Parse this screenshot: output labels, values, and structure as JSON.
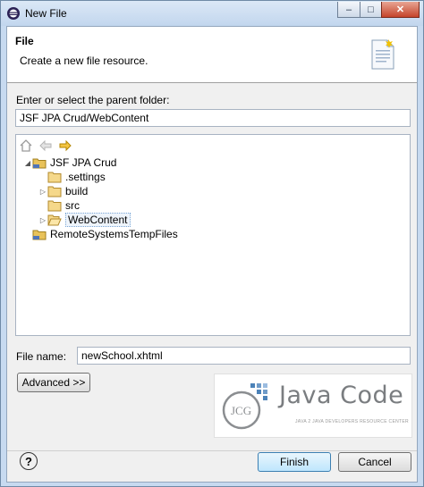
{
  "window": {
    "title": "New File"
  },
  "titlebar": {
    "minimize": "–",
    "maximize": "□",
    "close": "✕"
  },
  "banner": {
    "title": "File",
    "description": "Create a new file resource."
  },
  "parent": {
    "label": "Enter or select the parent folder:",
    "value": "JSF JPA Crud/WebContent"
  },
  "tree": {
    "items": [
      {
        "label": "JSF JPA Crud",
        "arrow": "◢"
      },
      {
        "label": ".settings",
        "arrow": ""
      },
      {
        "label": "build",
        "arrow": "▷"
      },
      {
        "label": "src",
        "arrow": ""
      },
      {
        "label": "WebContent",
        "arrow": "▷"
      },
      {
        "label": "RemoteSystemsTempFiles",
        "arrow": ""
      }
    ]
  },
  "filename": {
    "label": "File name:",
    "value": "newSchool.xhtml"
  },
  "buttons": {
    "advanced": "Advanced >>",
    "finish": "Finish",
    "cancel": "Cancel",
    "help": "?"
  },
  "logo": {
    "text": "Java Code Geeks",
    "sub": "JAVA 2 JAVA DEVELOPERS RESOURCE CENTER"
  }
}
